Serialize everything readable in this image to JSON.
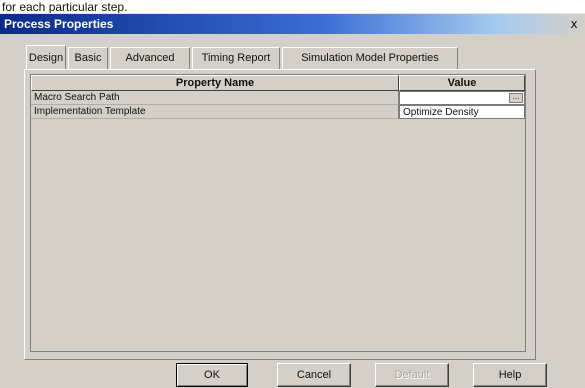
{
  "caption": "for each particular step.",
  "window": {
    "title": "Process Properties",
    "close_glyph": "x"
  },
  "tabs": [
    {
      "label": "Design",
      "active": true
    },
    {
      "label": "Basic",
      "active": false
    },
    {
      "label": "Advanced",
      "active": false
    },
    {
      "label": "Timing Report",
      "active": false
    },
    {
      "label": "Simulation Model Properties",
      "active": false
    }
  ],
  "grid": {
    "headers": {
      "name": "Property Name",
      "value": "Value"
    },
    "rows": [
      {
        "name": "Macro Search Path",
        "value": "",
        "browse": "..."
      },
      {
        "name": "Implementation Template",
        "value": "Optimize Density"
      }
    ]
  },
  "buttons": {
    "ok": "OK",
    "cancel": "Cancel",
    "default": "Default",
    "help": "Help"
  },
  "icons": {
    "close": "close-icon",
    "browse": "ellipsis-icon"
  }
}
